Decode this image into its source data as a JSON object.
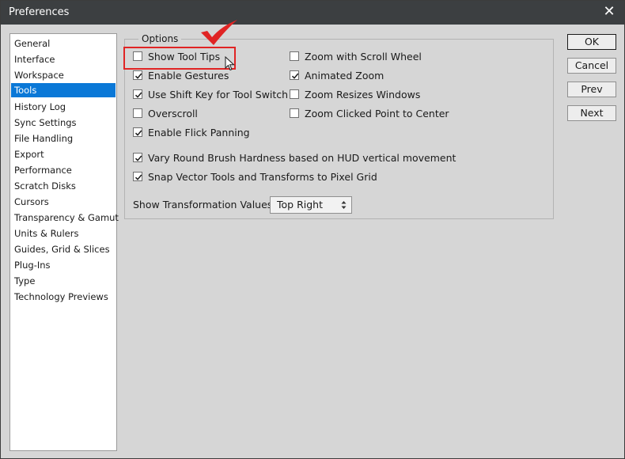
{
  "window": {
    "title": "Preferences"
  },
  "sidebar": {
    "items": [
      {
        "label": "General",
        "selected": false
      },
      {
        "label": "Interface",
        "selected": false
      },
      {
        "label": "Workspace",
        "selected": false
      },
      {
        "label": "Tools",
        "selected": true
      },
      {
        "label": "History Log",
        "selected": false
      },
      {
        "label": "Sync Settings",
        "selected": false
      },
      {
        "label": "File Handling",
        "selected": false
      },
      {
        "label": "Export",
        "selected": false
      },
      {
        "label": "Performance",
        "selected": false
      },
      {
        "label": "Scratch Disks",
        "selected": false
      },
      {
        "label": "Cursors",
        "selected": false
      },
      {
        "label": "Transparency & Gamut",
        "selected": false
      },
      {
        "label": "Units & Rulers",
        "selected": false
      },
      {
        "label": "Guides, Grid & Slices",
        "selected": false
      },
      {
        "label": "Plug-Ins",
        "selected": false
      },
      {
        "label": "Type",
        "selected": false
      },
      {
        "label": "Technology Previews",
        "selected": false
      }
    ]
  },
  "options": {
    "legend": "Options",
    "left_column": [
      {
        "label": "Show Tool Tips",
        "checked": false
      },
      {
        "label": "Enable Gestures",
        "checked": true
      },
      {
        "label": "Use Shift Key for Tool Switch",
        "checked": true
      },
      {
        "label": "Overscroll",
        "checked": false
      },
      {
        "label": "Enable Flick Panning",
        "checked": true
      }
    ],
    "right_column": [
      {
        "label": "Zoom with Scroll Wheel",
        "checked": false
      },
      {
        "label": "Animated Zoom",
        "checked": true
      },
      {
        "label": "Zoom Resizes Windows",
        "checked": false
      },
      {
        "label": "Zoom Clicked Point to Center",
        "checked": false
      }
    ],
    "wide": [
      {
        "label": "Vary Round Brush Hardness based on HUD vertical movement",
        "checked": true
      },
      {
        "label": "Snap Vector Tools and Transforms to Pixel Grid",
        "checked": true
      }
    ],
    "transformation": {
      "label": "Show Transformation Values:",
      "value": "Top Right"
    }
  },
  "buttons": {
    "ok": "OK",
    "cancel": "Cancel",
    "prev": "Prev",
    "next": "Next"
  },
  "colors": {
    "selection": "#0a78d7",
    "annotation": "#e02424"
  }
}
